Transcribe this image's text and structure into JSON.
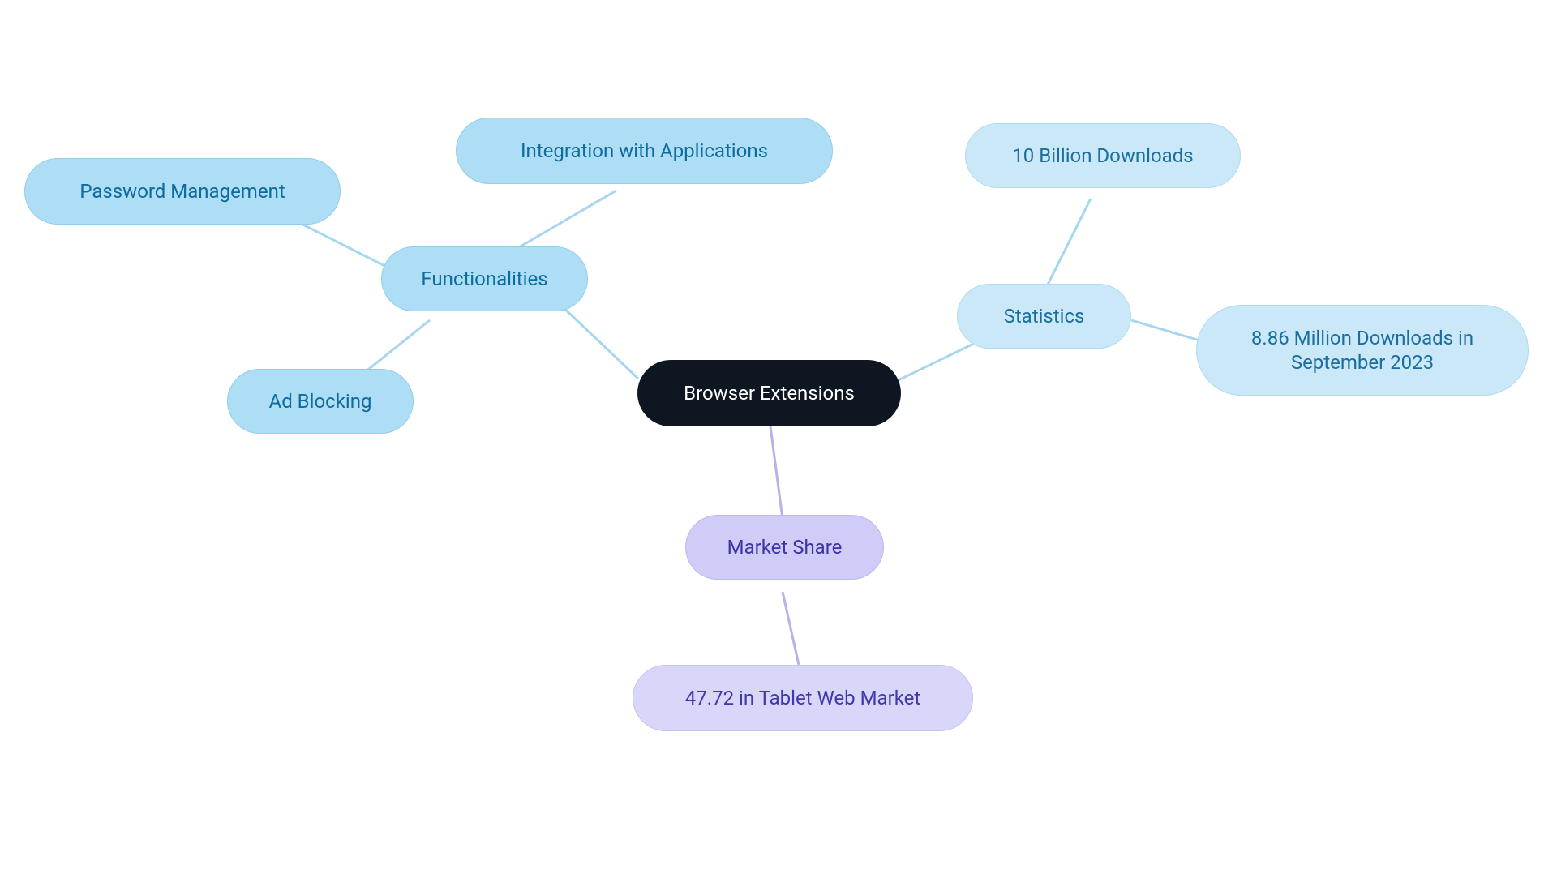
{
  "diagram": {
    "type": "mindmap",
    "center": {
      "label": "Browser Extensions"
    },
    "branches": {
      "functionalities": {
        "label": "Functionalities",
        "children": {
          "password_mgmt": "Password Management",
          "integration": "Integration with Applications",
          "ad_blocking": "Ad Blocking"
        }
      },
      "statistics": {
        "label": "Statistics",
        "children": {
          "ten_billion": "10 Billion Downloads",
          "sept_2023": "8.86 Million Downloads in\nSeptember 2023"
        }
      },
      "market_share": {
        "label": "Market Share",
        "children": {
          "tablet": "47.72 in Tablet Web Market"
        }
      }
    }
  },
  "colors": {
    "center_bg": "#0e1621",
    "center_text": "#ffffff",
    "blue_mid_bg": "#aedef5",
    "blue_light_bg": "#cae8f8",
    "blue_text": "#0e6b9e",
    "purple_mid_bg": "#cfccf7",
    "purple_light_bg": "#d9d7f9",
    "purple_text": "#3d34a8",
    "edge_blue": "#a7d6ee",
    "edge_purple": "#b7b2e8"
  }
}
